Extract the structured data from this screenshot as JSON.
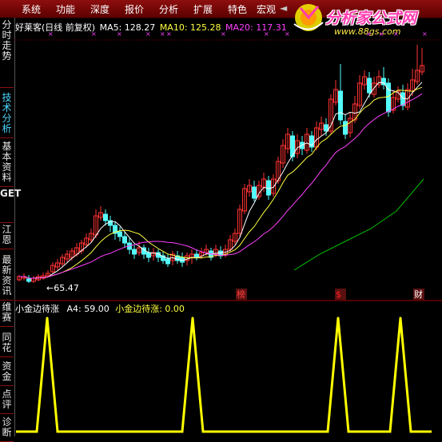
{
  "menu": [
    "系统",
    "功能",
    "深度",
    "报价",
    "分析",
    "扩展",
    "特色",
    "宏观"
  ],
  "menu_arrow": "◄",
  "logo": {
    "title": "分析家公式网",
    "url": "www.88gs.com"
  },
  "sidebar": [
    "分时走势",
    "技术分析",
    "基本资料",
    "GET",
    "江恩",
    "最新资讯",
    "维赛",
    "同花",
    "资金",
    "点评",
    "诊断"
  ],
  "main_info": {
    "stock": "好莱客(日线 前复权)",
    "ma5": "MA5: 128.27",
    "ma10": "MA10: 125.28",
    "ma20": "MA20: 117.31"
  },
  "sub_info": {
    "name": "小金边待涨",
    "a4": "A4: 59.00",
    "value": "小金边待涨: 0.00"
  },
  "low_label": "←65.47",
  "event_marks": [
    "榜",
    "$",
    "财"
  ],
  "colors": {
    "up": "#ff3232",
    "down": "#54fcfc",
    "ma5": "#ffffff",
    "ma10": "#ffff40",
    "ma20": "#ff40ff",
    "ma60": "#00c000",
    "signal": "#ffff00",
    "axis": "#a00000"
  },
  "chart_data": {
    "type": "line",
    "series": [
      {
        "name": "小金边待涨",
        "values": [
          0,
          0,
          0,
          59,
          0,
          0,
          0,
          0,
          0,
          0,
          0,
          0,
          0,
          0,
          0,
          0,
          0,
          59,
          0,
          0,
          0,
          0,
          0,
          0,
          0,
          0,
          0,
          0,
          0,
          0,
          0,
          59,
          0,
          0,
          0,
          0,
          0,
          59,
          0,
          0,
          0
        ]
      }
    ]
  }
}
